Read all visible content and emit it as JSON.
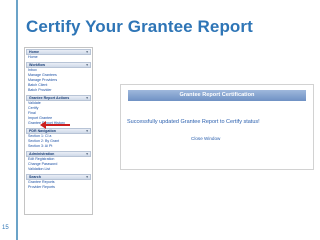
{
  "slide": {
    "title": "Certify Your Grantee Report",
    "page_number": "15"
  },
  "nav": {
    "sections": [
      {
        "header": "Home",
        "items": [
          "Home"
        ]
      },
      {
        "header": "Workflow",
        "items": [
          "Inbox",
          "Manage Grantees",
          "Manage Providers",
          "Batch Client",
          "Batch Provider"
        ]
      },
      {
        "header": "Grantee Report Actions",
        "items": [
          "Validate",
          "Certify",
          "Final",
          "Import Grantee",
          "Grantee Report History"
        ]
      },
      {
        "header": "PDR Navigation",
        "items": [
          "Section 1: Cl a",
          "Section 2: By Grant",
          "Section 3: Ai Pt"
        ]
      },
      {
        "header": "Administration",
        "items": [
          "Edit Registration",
          "Change Password",
          "Validation List"
        ]
      },
      {
        "header": "Search",
        "items": [
          "Grantee Reports",
          "Provider Reports"
        ]
      }
    ],
    "chevron_icon": "chevron-down-icon"
  },
  "certification": {
    "header": "Grantee Report Certification",
    "message": "Successfully updated Grantee Report to Certify status!",
    "close_link": "Close Window"
  },
  "colors": {
    "title": "#2e75b6",
    "arrow": "#cc1e1e",
    "link": "#1a4fa3",
    "dialog_header": "#7f9fcf"
  }
}
